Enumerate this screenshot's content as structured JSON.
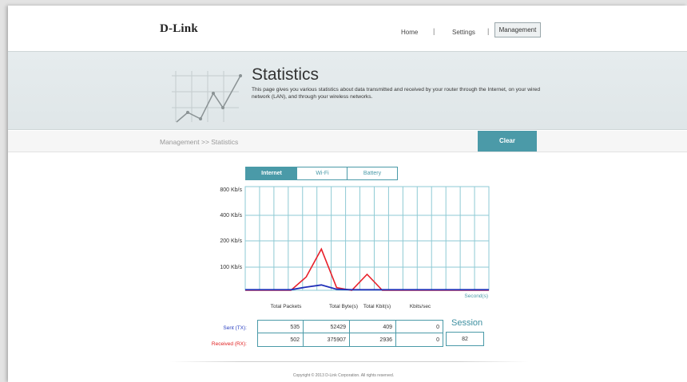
{
  "brand": "D-Link",
  "nav": {
    "home": "Home",
    "settings": "Settings",
    "management": "Management",
    "separator": "|"
  },
  "banner": {
    "title": "Statistics",
    "description": "This page gives you various statistics about data transmitted and received by your router through the Internet, on your wired network (LAN), and through your wireless networks."
  },
  "breadcrumb": "Management >> Statistics",
  "clear_label": "Clear",
  "tabs": [
    {
      "label": "Internet",
      "active": true
    },
    {
      "label": "Wi-Fi",
      "active": false
    },
    {
      "label": "Battery",
      "active": false
    }
  ],
  "chart_data": {
    "type": "line",
    "y_tick_labels": [
      "800 Kb/s",
      "400 Kb/s",
      "200 Kb/s",
      "100 Kb/s"
    ],
    "x_label": "Second(s)",
    "grid": true,
    "series": [
      {
        "color": "#e8202a",
        "values": [
          0,
          0,
          0,
          0,
          50,
          155,
          10,
          0,
          60,
          0,
          0,
          0,
          0,
          0,
          0,
          0,
          0
        ]
      },
      {
        "color": "#1f2fb8",
        "values": [
          2,
          2,
          2,
          2,
          12,
          20,
          4,
          2,
          2,
          2,
          2,
          2,
          2,
          2,
          2,
          2,
          2
        ]
      }
    ]
  },
  "stats": {
    "headers": [
      "Total Packets",
      "Total Byte(s)",
      "Total Kbit(s)",
      "Kbits/sec"
    ],
    "rows": [
      {
        "label": "Sent (TX):",
        "color": "#2a3fc0",
        "values": [
          "535",
          "52429",
          "409",
          "0"
        ]
      },
      {
        "label": "Received (RX):",
        "color": "#e02020",
        "values": [
          "502",
          "375907",
          "2936",
          "0"
        ]
      }
    ],
    "session_label": "Session",
    "session_value": "82"
  },
  "copyright": "Copyright © 2013 D-Link Corporation. All rights reserved."
}
